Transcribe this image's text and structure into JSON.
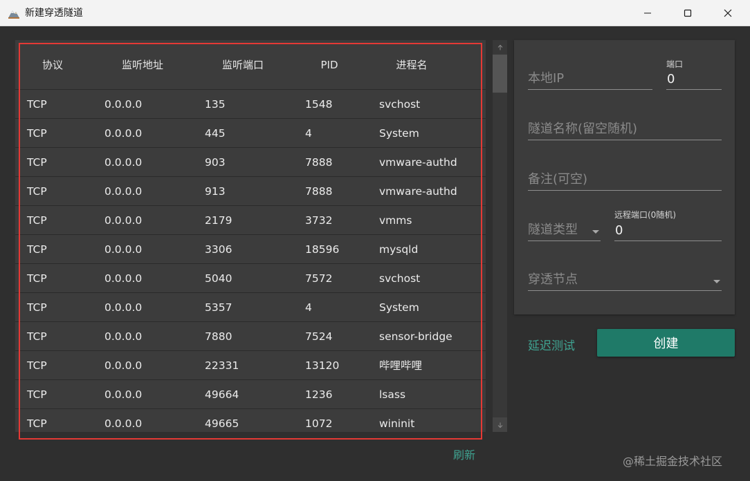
{
  "window": {
    "title": "新建穿透隧道",
    "app_icon": "mountain-app-icon"
  },
  "table": {
    "headers": [
      "协议",
      "监听地址",
      "监听端口",
      "PID",
      "进程名"
    ],
    "rows": [
      [
        "TCP",
        "0.0.0.0",
        "135",
        "1548",
        "svchost"
      ],
      [
        "TCP",
        "0.0.0.0",
        "445",
        "4",
        "System"
      ],
      [
        "TCP",
        "0.0.0.0",
        "903",
        "7888",
        "vmware-authd"
      ],
      [
        "TCP",
        "0.0.0.0",
        "913",
        "7888",
        "vmware-authd"
      ],
      [
        "TCP",
        "0.0.0.0",
        "2179",
        "3732",
        "vmms"
      ],
      [
        "TCP",
        "0.0.0.0",
        "3306",
        "18596",
        "mysqld"
      ],
      [
        "TCP",
        "0.0.0.0",
        "5040",
        "7572",
        "svchost"
      ],
      [
        "TCP",
        "0.0.0.0",
        "5357",
        "4",
        "System"
      ],
      [
        "TCP",
        "0.0.0.0",
        "7880",
        "7524",
        "sensor-bridge"
      ],
      [
        "TCP",
        "0.0.0.0",
        "22331",
        "13120",
        "哔哩哔哩"
      ],
      [
        "TCP",
        "0.0.0.0",
        "49664",
        "1236",
        "lsass"
      ],
      [
        "TCP",
        "0.0.0.0",
        "49665",
        "1072",
        "wininit"
      ]
    ],
    "refresh_label": "刷新"
  },
  "form": {
    "local_ip": {
      "placeholder": "本地IP",
      "value": ""
    },
    "port": {
      "label": "端口",
      "value": "0"
    },
    "tunnel_name": {
      "placeholder": "隧道名称(留空随机)",
      "value": ""
    },
    "note": {
      "placeholder": "备注(可空)",
      "value": ""
    },
    "tunnel_type": {
      "placeholder": "隧道类型",
      "value": ""
    },
    "remote_port": {
      "label": "远程端口(0随机)",
      "value": "0"
    },
    "node": {
      "placeholder": "穿透节点",
      "value": ""
    }
  },
  "actions": {
    "latency_test": "延迟测试",
    "create": "创建"
  },
  "watermark": "@稀土掘金技术社区",
  "colors": {
    "accent": "#1f7a68",
    "link": "#3fa391",
    "highlight_frame": "#e53935",
    "background": "#2f2f2f",
    "panel": "#3c3c3c"
  }
}
